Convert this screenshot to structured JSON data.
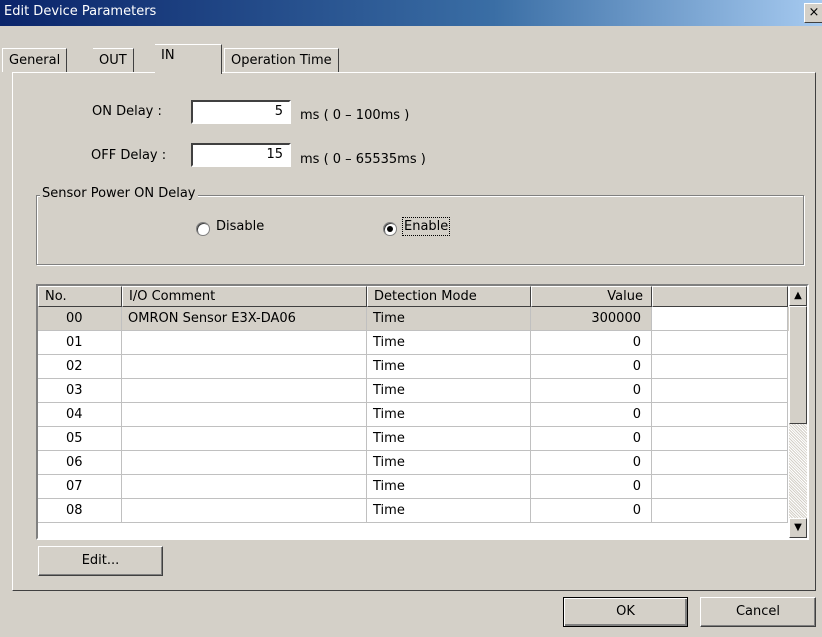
{
  "window": {
    "title": "Edit Device Parameters",
    "close_glyph": "×"
  },
  "tabs": [
    {
      "label": "General",
      "active": false
    },
    {
      "label": "OUT",
      "active": false
    },
    {
      "label": "IN",
      "active": true
    },
    {
      "label": "Operation Time",
      "active": false
    }
  ],
  "on_delay": {
    "label": "ON Delay :",
    "value": "5",
    "range": "ms ( 0 – 100ms )"
  },
  "off_delay": {
    "label": "OFF Delay :",
    "value": "15",
    "range": "ms ( 0 – 65535ms )"
  },
  "sensor_power": {
    "title": "Sensor Power ON Delay",
    "disable_label": "Disable",
    "enable_label": "Enable",
    "selected": "Enable"
  },
  "table": {
    "columns": [
      "No.",
      "I/O Comment",
      "Detection Mode",
      "Value",
      ""
    ],
    "rows": [
      {
        "no": "00",
        "comment": "OMRON Sensor E3X-DA06",
        "mode": "Time",
        "value": "300000"
      },
      {
        "no": "01",
        "comment": "",
        "mode": "Time",
        "value": "0"
      },
      {
        "no": "02",
        "comment": "",
        "mode": "Time",
        "value": "0"
      },
      {
        "no": "03",
        "comment": "",
        "mode": "Time",
        "value": "0"
      },
      {
        "no": "04",
        "comment": "",
        "mode": "Time",
        "value": "0"
      },
      {
        "no": "05",
        "comment": "",
        "mode": "Time",
        "value": "0"
      },
      {
        "no": "06",
        "comment": "",
        "mode": "Time",
        "value": "0"
      },
      {
        "no": "07",
        "comment": "",
        "mode": "Time",
        "value": "0"
      },
      {
        "no": "08",
        "comment": "",
        "mode": "Time",
        "value": "0"
      }
    ]
  },
  "buttons": {
    "edit": "Edit...",
    "ok": "OK",
    "cancel": "Cancel"
  },
  "scroll": {
    "up": "▲",
    "down": "▼"
  },
  "colors": {
    "selected_row": "#d4d0c8",
    "titlebar_start": "#0a246a",
    "titlebar_end": "#a6caf0"
  }
}
